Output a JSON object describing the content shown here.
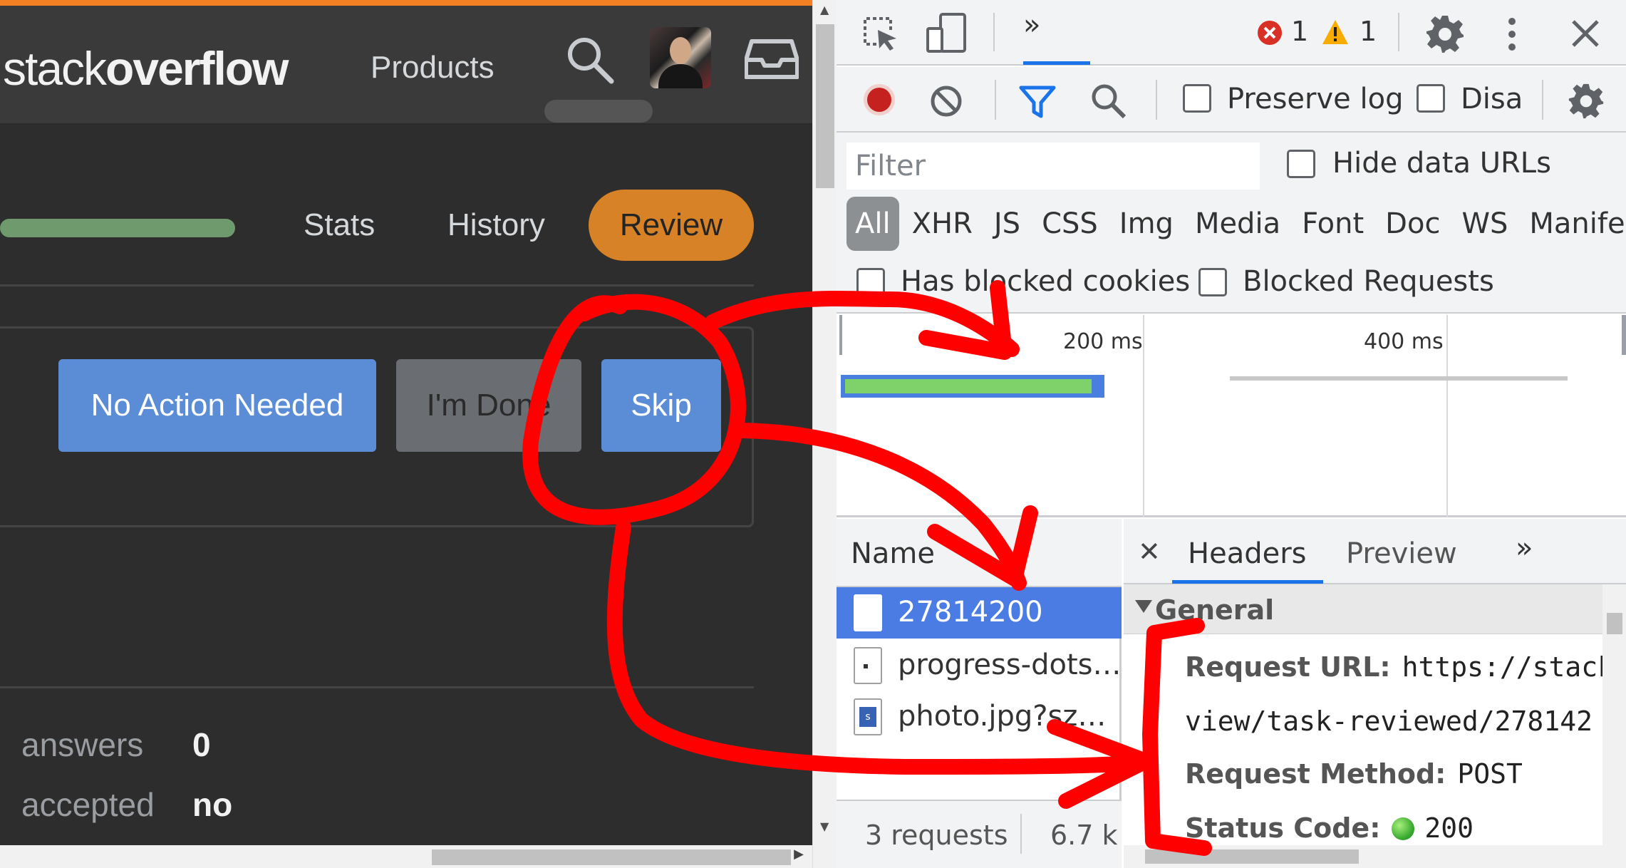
{
  "stackoverflow": {
    "logo_light": "stack",
    "logo_bold": "overflow",
    "nav_products": "Products",
    "tabs": [
      {
        "label": "Stats"
      },
      {
        "label": "History"
      },
      {
        "label": "Review",
        "active": true
      }
    ],
    "actions": {
      "no_action": "No Action Needed",
      "done": "I'm Done",
      "skip": "Skip"
    },
    "stats": [
      {
        "label": "answers",
        "value": "0"
      },
      {
        "label": "accepted",
        "value": "no"
      }
    ],
    "icons": [
      "search-icon",
      "avatar",
      "inbox-icon"
    ],
    "colors": {
      "accent": "#f48024",
      "review_tab": "#d88227",
      "button": "#5b8dd6",
      "progress": "#6e9a6e"
    }
  },
  "devtools": {
    "top_bar": {
      "more_tabs": "»",
      "error_count": "1",
      "warning_count": "1",
      "icons": [
        "inspect-icon",
        "device-toggle-icon",
        "error-icon",
        "warning-icon",
        "settings-icon",
        "more-vertical-icon",
        "close-icon"
      ]
    },
    "toolbar": {
      "preserve_log": "Preserve log",
      "disable_cache": "Disa",
      "icons": [
        "record-icon",
        "clear-icon",
        "filter-icon",
        "search-icon",
        "settings-icon"
      ]
    },
    "filter": {
      "placeholder": "Filter",
      "hide_data_urls": "Hide data URLs",
      "types": [
        "All",
        "XHR",
        "JS",
        "CSS",
        "Img",
        "Media",
        "Font",
        "Doc",
        "WS",
        "Manife"
      ],
      "active_type": "All",
      "has_blocked_cookies": "Has blocked cookies",
      "blocked_requests": "Blocked Requests"
    },
    "overview": {
      "ticks": [
        "200 ms",
        "400 ms"
      ]
    },
    "requests": {
      "column": "Name",
      "items": [
        {
          "name": "27814200",
          "selected": true
        },
        {
          "name": "progress-dots…"
        },
        {
          "name": "photo.jpg?sz…"
        }
      ],
      "count": "3 requests",
      "transferred": "6.7 k"
    },
    "details": {
      "close": "✕",
      "tabs": [
        "Headers",
        "Preview"
      ],
      "more": "»",
      "section": "General",
      "request_url_label": "Request URL:",
      "request_url_value": "https://stack",
      "request_url_cont": "view/task-reviewed/278142",
      "method_label": "Request Method:",
      "method_value": "POST",
      "status_label": "Status Code:",
      "status_value": "200"
    }
  },
  "annotation": {
    "color": "#ff0000"
  }
}
